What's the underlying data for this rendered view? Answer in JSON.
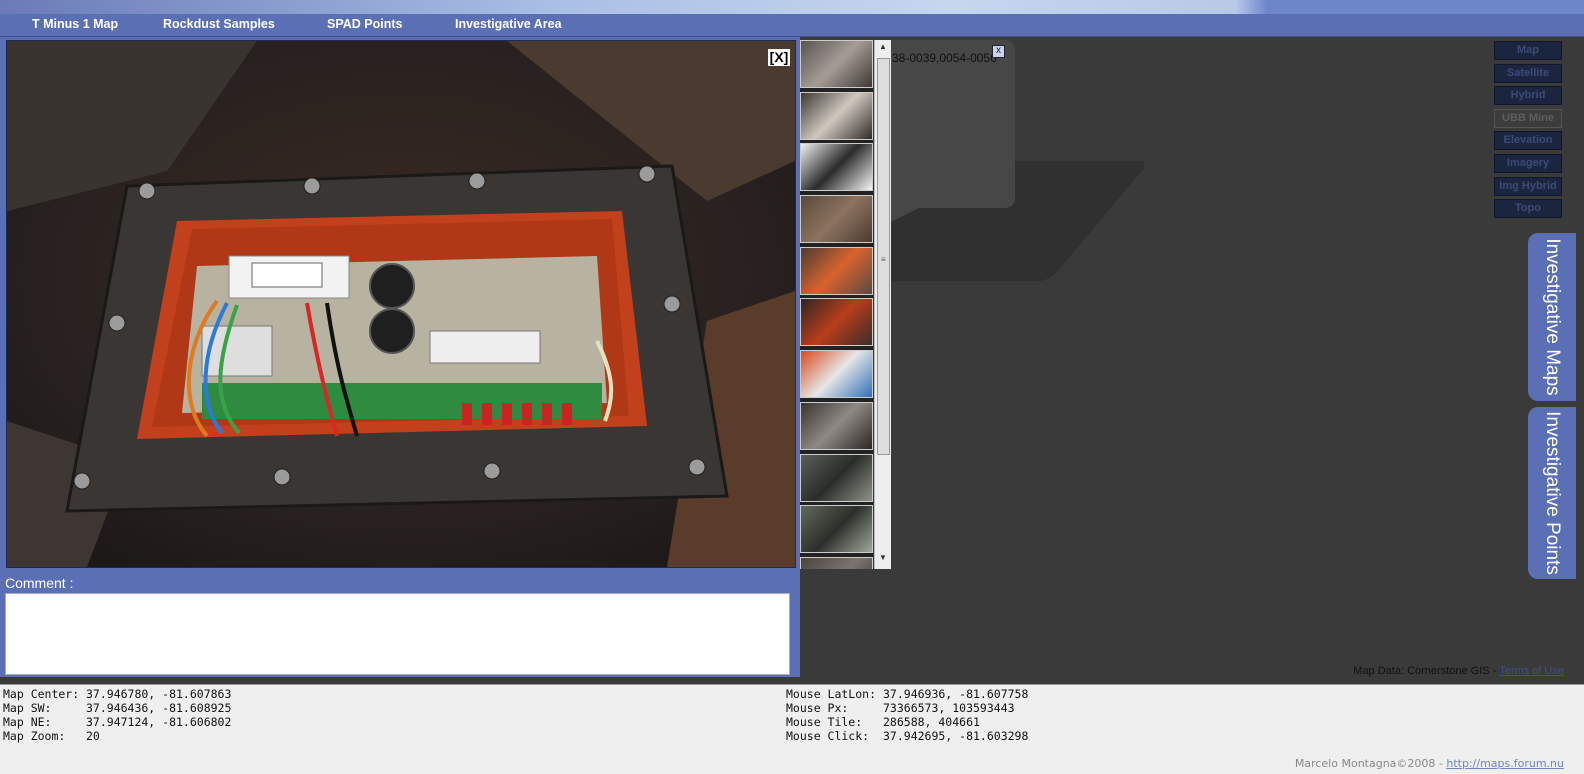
{
  "menu": {
    "items": [
      {
        "label": "T Minus 1 Map"
      },
      {
        "label": "Rockdust Samples"
      },
      {
        "label": "SPAD Points"
      },
      {
        "label": "Investigative Area"
      }
    ]
  },
  "viewer": {
    "close_label": "[X]",
    "comment_label": "Comment :",
    "comment_value": ""
  },
  "bubble": {
    "title": "38-0039,0054-0056",
    "close_label": "x"
  },
  "map_types": [
    {
      "label": "Map",
      "active": false
    },
    {
      "label": "Satellite",
      "active": false
    },
    {
      "label": "Hybrid",
      "active": false
    },
    {
      "label": "UBB Mine",
      "active": true
    },
    {
      "label": "Elevation",
      "active": false
    },
    {
      "label": "Imagery",
      "active": false
    },
    {
      "label": "Img Hybrid",
      "active": false
    },
    {
      "label": "Topo",
      "active": false
    }
  ],
  "side_tabs": [
    {
      "label": "Investigative Maps"
    },
    {
      "label": "Investigative Points"
    }
  ],
  "attribution": {
    "text": "Map Data: Cornerstone GIS - ",
    "link": "Terms of Use"
  },
  "status": {
    "left": [
      {
        "label": "Map Center:",
        "value": "37.946780, -81.607863"
      },
      {
        "label": "Map SW:",
        "value": "37.946436, -81.608925"
      },
      {
        "label": "Map NE:",
        "value": "37.947124, -81.606802"
      },
      {
        "label": "Map Zoom:",
        "value": "20"
      }
    ],
    "right": [
      {
        "label": "Mouse LatLon:",
        "value": "37.946936, -81.607758"
      },
      {
        "label": "Mouse Px:",
        "value": "73366573, 103593443"
      },
      {
        "label": "Mouse Tile:",
        "value": "286588, 404661"
      },
      {
        "label": "Mouse Click:",
        "value": "37.942695, -81.603298"
      }
    ]
  },
  "credit": {
    "text": "Marcelo Montagna©2008 - ",
    "link": "http://maps.forum.nu"
  },
  "colors": {
    "menu_blue": "#5b6fb5",
    "map_bg": "#3a3a3a",
    "status_bg": "#efefef"
  }
}
